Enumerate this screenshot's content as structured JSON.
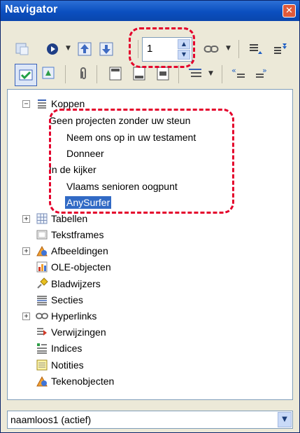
{
  "window": {
    "title": "Navigator",
    "close_symbol": "✕"
  },
  "toolbar": {
    "page_number": "1",
    "buttons_row1": [
      "toggle-icon",
      "navigation-icon",
      "previous-icon",
      "next-icon",
      "link-icon",
      "content-view-icon",
      "promote-chapter-icon"
    ],
    "buttons_row2": [
      "content-navigation-icon",
      "master-view-icon",
      "drag-mode-icon",
      "header-icon",
      "footer-icon",
      "anchor-icon",
      "heading-levels-icon",
      "promote-level-icon",
      "demote-level-icon"
    ]
  },
  "tree": {
    "koppen": "Koppen",
    "headings": [
      "Geen projecten zonder uw steun",
      "Neem ons op in uw testament",
      "Donneer",
      "In de kijker",
      "Vlaams senioren oogpunt",
      "AnySurfer"
    ],
    "categories": [
      "Tabellen",
      "Tekstframes",
      "Afbeeldingen",
      "OLE-objecten",
      "Bladwijzers",
      "Secties",
      "Hyperlinks",
      "Verwijzingen",
      "Indices",
      "Notities",
      "Tekenobjecten"
    ],
    "selected": "AnySurfer"
  },
  "document_select": {
    "value": "naamloos1 (actief)"
  },
  "colors": {
    "titlebar": "#0b4fbf",
    "selection": "#316ac5",
    "highlight": "#e4002b",
    "panel": "#ece9d8"
  }
}
